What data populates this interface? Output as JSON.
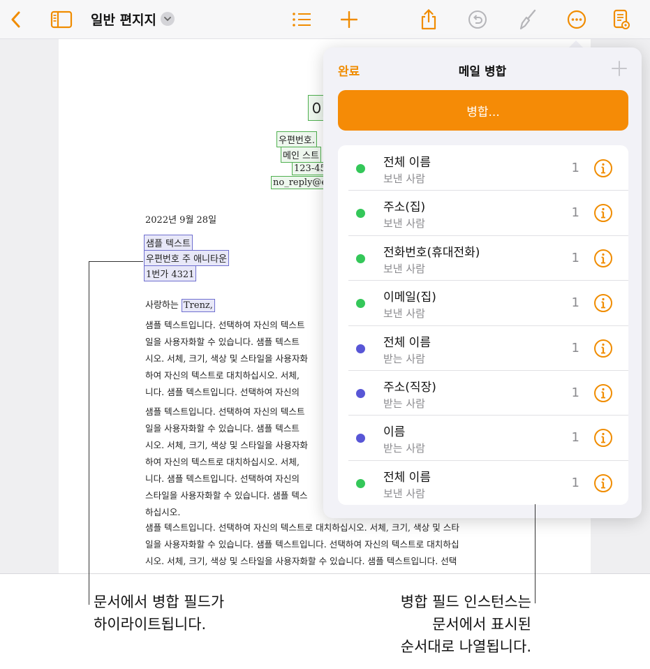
{
  "toolbar": {
    "doc_title": "일반 편지지",
    "icons": [
      "back-chevron-icon",
      "sidebar-icon",
      "chevron-down-icon",
      "list-icon",
      "plus-icon",
      "share-icon",
      "undo-icon",
      "brush-icon",
      "more-icon",
      "reading-view-icon"
    ],
    "accent": "#f08c00"
  },
  "document": {
    "letterhead": {
      "name_frag": "이",
      "line1": "우편번호. ",
      "line2": "메인 스트",
      "line3": "123-45",
      "line4": "no_reply@e"
    },
    "date": "2022년 9월 28일",
    "address": [
      "샘플 텍스트",
      "우편번호 주 애니타운",
      "1번가 4321"
    ],
    "greeting_prefix": "사랑하는 ",
    "greeting_name": "Trenz,",
    "paragraphs": [
      "샘플 텍스트입니다. 선택하여 자신의 텍스트\n일을 사용자화할 수 있습니다. 샘플 텍스트\n시오. 서체, 크기, 색상 및 스타일을 사용자화\n하여 자신의 텍스트로 대치하십시오. 서체,\n니다. 샘플 텍스트입니다. 선택하여 자신의",
      "샘플 텍스트입니다. 선택하여 자신의 텍스트\n일을 사용자화할 수 있습니다. 샘플 텍스트\n시오. 서체, 크기, 색상 및 스타일을 사용자화\n하여 자신의 텍스트로 대치하십시오. 서체,\n니다. 샘플 텍스트입니다. 선택하여 자신의\n스타일을 사용자화할 수 있습니다. 샘플 텍스\n하십시오.",
      "샘플 텍스트입니다. 선택하여 자신의 텍스트로 대치하십시오. 서체, 크기, 색상 및 스타\n일을 사용자화할 수 있습니다. 샘플 텍스트입니다. 선택하여 자신의 텍스트로 대치하십\n시오. 서체, 크기, 색상 및 스타일을 사용자화할 수 있습니다. 샘플 텍스트입니다. 선택\n하여 자신의 텍스트로 대치하십시오. 서체, 크기, 색상 및 스타일을 사용자화할 수 있습"
    ]
  },
  "popover": {
    "done_label": "완료",
    "title": "메일 병합",
    "merge_label": "병합...",
    "fields": [
      {
        "name": "전체 이름",
        "source": "보낸 사람",
        "count": "1",
        "dot_color": "#34c759"
      },
      {
        "name": "주소(집)",
        "source": "보낸 사람",
        "count": "1",
        "dot_color": "#34c759"
      },
      {
        "name": "전화번호(휴대전화)",
        "source": "보낸 사람",
        "count": "1",
        "dot_color": "#34c759"
      },
      {
        "name": "이메일(집)",
        "source": "보낸 사람",
        "count": "1",
        "dot_color": "#34c759"
      },
      {
        "name": "전체 이름",
        "source": "받는 사람",
        "count": "1",
        "dot_color": "#5856d6"
      },
      {
        "name": "주소(직장)",
        "source": "받는 사람",
        "count": "1",
        "dot_color": "#5856d6"
      },
      {
        "name": "이름",
        "source": "받는 사람",
        "count": "1",
        "dot_color": "#5856d6"
      },
      {
        "name": "전체 이름",
        "source": "보낸 사람",
        "count": "1",
        "dot_color": "#34c759"
      }
    ]
  },
  "captions": {
    "left": [
      "문서에서 병합 필드가",
      "하이라이트됩니다."
    ],
    "right": [
      "병합 필드 인스턴스는",
      "문서에서 표시된",
      "순서대로 나열됩니다."
    ]
  }
}
